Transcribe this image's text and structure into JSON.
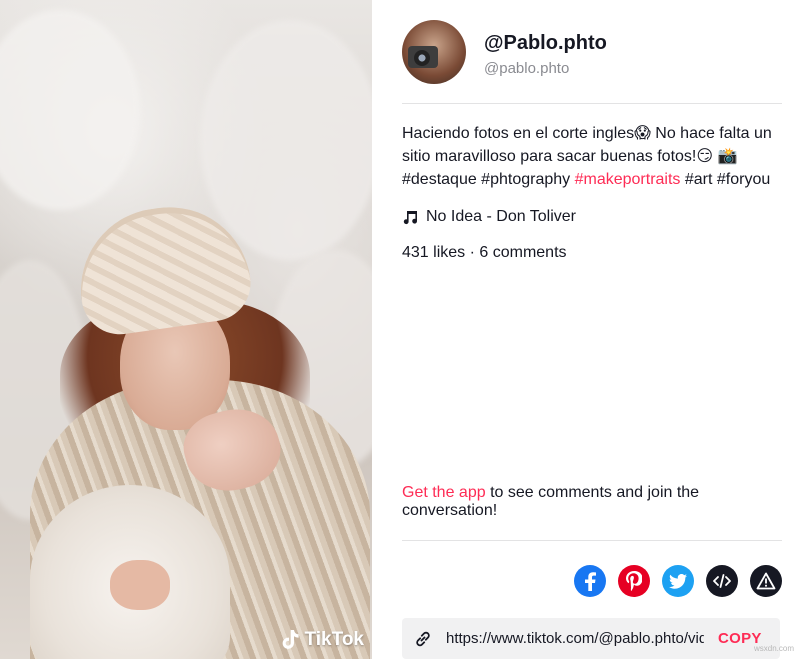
{
  "brand": {
    "watermark": "TikTok",
    "accent": "#fe2c55"
  },
  "author": {
    "display_name": "@Pablo.phto",
    "handle": "@pablo.phto"
  },
  "post": {
    "caption_line1": "Haciendo fotos en el corte ingles😱  No hace falta un sitio maravilloso para sacar buenas fotos!😏 📸",
    "hashtags_before": "#destaque #phtography ",
    "hashtag_highlight": "#makeportraits",
    "hashtags_after": " #art #foryou",
    "music": "No Idea - Don Toliver",
    "stats": "431 likes · 6 comments"
  },
  "cta": {
    "link_text": "Get the app",
    "rest_text": " to see comments and join the conversation!"
  },
  "share": {
    "icons": [
      "facebook-icon",
      "pinterest-icon",
      "twitter-icon",
      "embed-icon",
      "report-icon"
    ],
    "colors": {
      "facebook": "#1877f2",
      "pinterest": "#e60023",
      "twitter": "#1da1f2",
      "embed": "#161823",
      "report": "#161823"
    }
  },
  "copy_link": {
    "url": "https://www.tiktok.com/@pablo.phto/vid",
    "button": "COPY"
  },
  "footer": {
    "watermark": "wsxdn.com"
  }
}
